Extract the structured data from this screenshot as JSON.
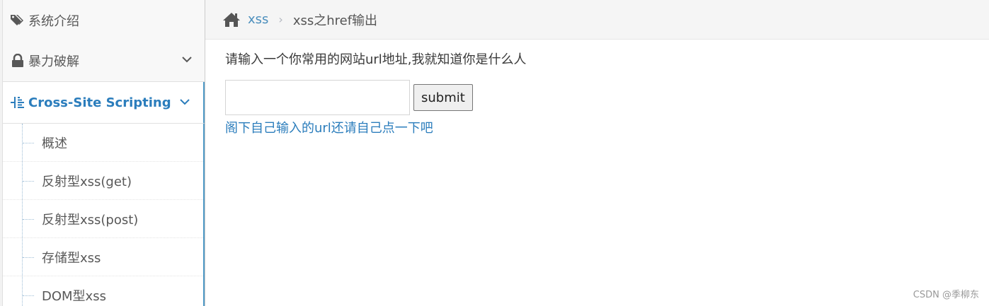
{
  "sidebar": {
    "items": [
      {
        "label": "系统介绍",
        "icon": "tags-icon"
      },
      {
        "label": "暴力破解",
        "icon": "lock-icon"
      },
      {
        "label": "Cross-Site Scripting",
        "icon": "list-tree-icon"
      }
    ],
    "submenu": [
      {
        "label": "概述"
      },
      {
        "label": "反射型xss(get)"
      },
      {
        "label": "反射型xss(post)"
      },
      {
        "label": "存储型xss"
      },
      {
        "label": "DOM型xss"
      }
    ]
  },
  "breadcrumb": {
    "home_icon": "home-icon",
    "parent": "xss",
    "separator": "›",
    "current": "xss之href输出"
  },
  "main": {
    "prompt": "请输入一个你常用的网站url地址,我就知道你是什么人",
    "input_value": "",
    "input_placeholder": "",
    "submit_label": "submit",
    "result_link": "阁下自己输入的url还请自己点一下吧"
  },
  "watermark": "CSDN @季柳东",
  "colors": {
    "accent": "#2b7dbc",
    "link": "#4c8fbd",
    "active_border": "#4f99c6"
  }
}
